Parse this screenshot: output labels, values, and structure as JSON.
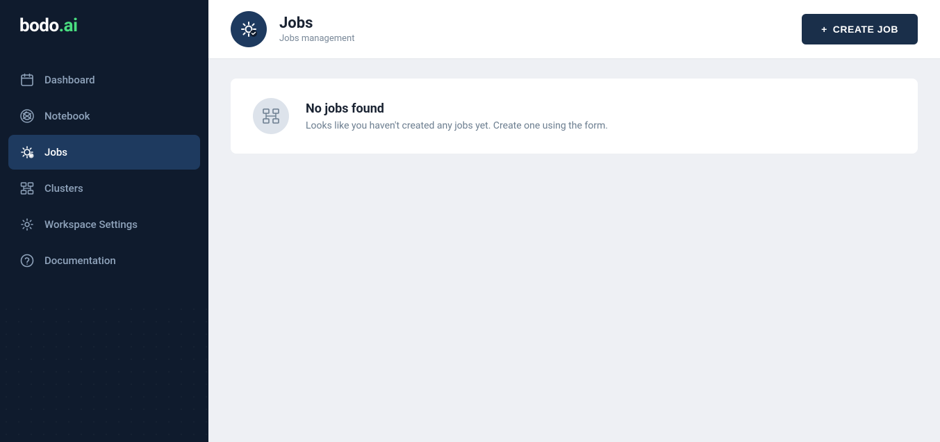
{
  "logo": {
    "text_bodo": "bodo",
    "text_ai": ".ai"
  },
  "sidebar": {
    "items": [
      {
        "id": "dashboard",
        "label": "Dashboard",
        "icon": "calendar-icon",
        "active": false
      },
      {
        "id": "notebook",
        "label": "Notebook",
        "icon": "notebook-icon",
        "active": false
      },
      {
        "id": "jobs",
        "label": "Jobs",
        "icon": "jobs-icon",
        "active": true
      },
      {
        "id": "clusters",
        "label": "Clusters",
        "icon": "clusters-icon",
        "active": false
      },
      {
        "id": "workspace-settings",
        "label": "Workspace Settings",
        "icon": "settings-icon",
        "active": false
      },
      {
        "id": "documentation",
        "label": "Documentation",
        "icon": "help-icon",
        "active": false
      }
    ]
  },
  "header": {
    "title": "Jobs",
    "subtitle": "Jobs management",
    "create_button_label": "CREATE JOB"
  },
  "empty_state": {
    "title": "No jobs found",
    "subtitle": "Looks like you haven't created any jobs yet. Create one using the form."
  }
}
